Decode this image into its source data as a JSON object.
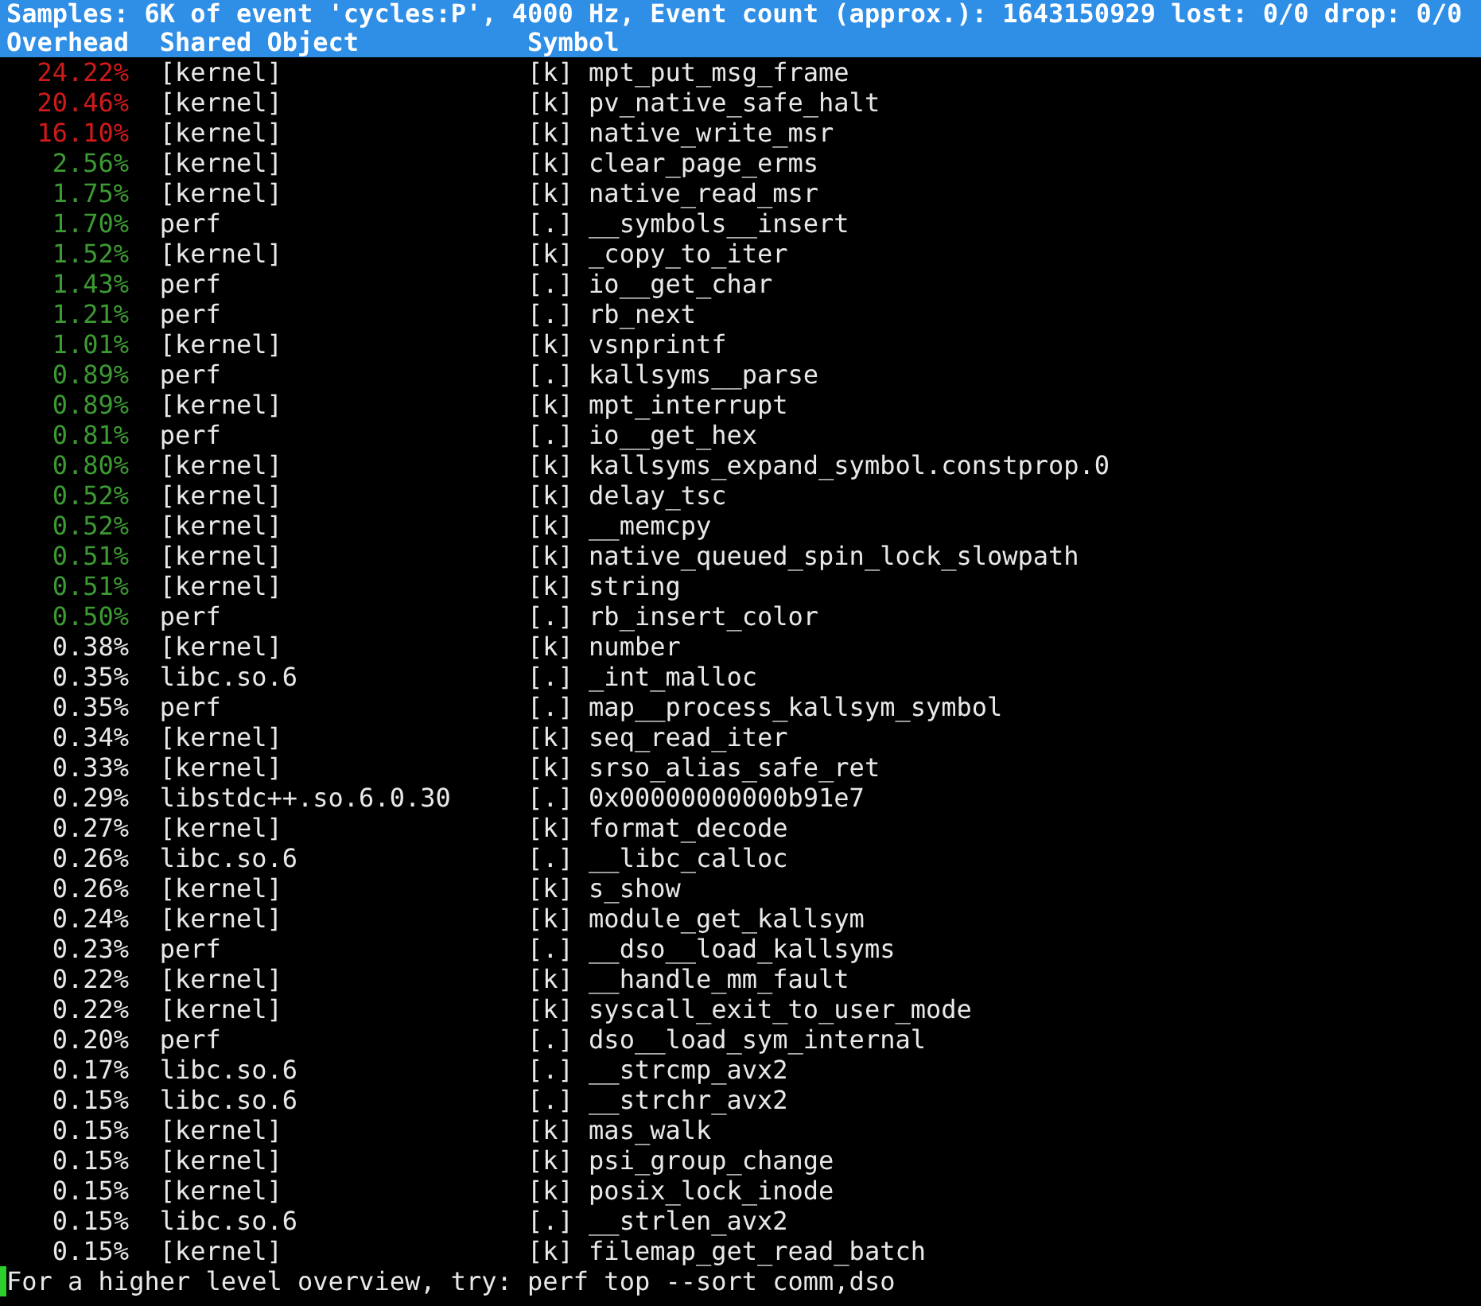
{
  "status_line": "Samples: 6K of event 'cycles:P', 4000 Hz, Event count (approx.): 1643150929 lost: 0/0 drop: 0/0",
  "columns": [
    "Overhead",
    "Shared Object",
    "Symbol"
  ],
  "rows": [
    {
      "overhead": "24.22%",
      "shared_object": "[kernel]",
      "symbol": "[k] mpt_put_msg_frame",
      "color": "#d01a1a"
    },
    {
      "overhead": "20.46%",
      "shared_object": "[kernel]",
      "symbol": "[k] pv_native_safe_halt",
      "color": "#d01a1a"
    },
    {
      "overhead": "16.10%",
      "shared_object": "[kernel]",
      "symbol": "[k] native_write_msr",
      "color": "#d01a1a"
    },
    {
      "overhead": "2.56%",
      "shared_object": "[kernel]",
      "symbol": "[k] clear_page_erms",
      "color": "#3c9a32"
    },
    {
      "overhead": "1.75%",
      "shared_object": "[kernel]",
      "symbol": "[k] native_read_msr",
      "color": "#3c9a32"
    },
    {
      "overhead": "1.70%",
      "shared_object": "perf",
      "symbol": "[.] __symbols__insert",
      "color": "#3c9a32"
    },
    {
      "overhead": "1.52%",
      "shared_object": "[kernel]",
      "symbol": "[k] _copy_to_iter",
      "color": "#3c9a32"
    },
    {
      "overhead": "1.43%",
      "shared_object": "perf",
      "symbol": "[.] io__get_char",
      "color": "#3c9a32"
    },
    {
      "overhead": "1.21%",
      "shared_object": "perf",
      "symbol": "[.] rb_next",
      "color": "#3c9a32"
    },
    {
      "overhead": "1.01%",
      "shared_object": "[kernel]",
      "symbol": "[k] vsnprintf",
      "color": "#3c9a32"
    },
    {
      "overhead": "0.89%",
      "shared_object": "perf",
      "symbol": "[.] kallsyms__parse",
      "color": "#3c9a32"
    },
    {
      "overhead": "0.89%",
      "shared_object": "[kernel]",
      "symbol": "[k] mpt_interrupt",
      "color": "#3c9a32"
    },
    {
      "overhead": "0.81%",
      "shared_object": "perf",
      "symbol": "[.] io__get_hex",
      "color": "#3c9a32"
    },
    {
      "overhead": "0.80%",
      "shared_object": "[kernel]",
      "symbol": "[k] kallsyms_expand_symbol.constprop.0",
      "color": "#3c9a32"
    },
    {
      "overhead": "0.52%",
      "shared_object": "[kernel]",
      "symbol": "[k] delay_tsc",
      "color": "#3c9a32"
    },
    {
      "overhead": "0.52%",
      "shared_object": "[kernel]",
      "symbol": "[k] __memcpy",
      "color": "#3c9a32"
    },
    {
      "overhead": "0.51%",
      "shared_object": "[kernel]",
      "symbol": "[k] native_queued_spin_lock_slowpath",
      "color": "#3c9a32"
    },
    {
      "overhead": "0.51%",
      "shared_object": "[kernel]",
      "symbol": "[k] string",
      "color": "#3c9a32"
    },
    {
      "overhead": "0.50%",
      "shared_object": "perf",
      "symbol": "[.] rb_insert_color",
      "color": "#3c9a32"
    },
    {
      "overhead": "0.38%",
      "shared_object": "[kernel]",
      "symbol": "[k] number",
      "color": "#e8e8e8"
    },
    {
      "overhead": "0.35%",
      "shared_object": "libc.so.6",
      "symbol": "[.] _int_malloc",
      "color": "#e8e8e8"
    },
    {
      "overhead": "0.35%",
      "shared_object": "perf",
      "symbol": "[.] map__process_kallsym_symbol",
      "color": "#e8e8e8"
    },
    {
      "overhead": "0.34%",
      "shared_object": "[kernel]",
      "symbol": "[k] seq_read_iter",
      "color": "#e8e8e8"
    },
    {
      "overhead": "0.33%",
      "shared_object": "[kernel]",
      "symbol": "[k] srso_alias_safe_ret",
      "color": "#e8e8e8"
    },
    {
      "overhead": "0.29%",
      "shared_object": "libstdc++.so.6.0.30",
      "symbol": "[.] 0x00000000000b91e7",
      "color": "#e8e8e8"
    },
    {
      "overhead": "0.27%",
      "shared_object": "[kernel]",
      "symbol": "[k] format_decode",
      "color": "#e8e8e8"
    },
    {
      "overhead": "0.26%",
      "shared_object": "libc.so.6",
      "symbol": "[.] __libc_calloc",
      "color": "#e8e8e8"
    },
    {
      "overhead": "0.26%",
      "shared_object": "[kernel]",
      "symbol": "[k] s_show",
      "color": "#e8e8e8"
    },
    {
      "overhead": "0.24%",
      "shared_object": "[kernel]",
      "symbol": "[k] module_get_kallsym",
      "color": "#e8e8e8"
    },
    {
      "overhead": "0.23%",
      "shared_object": "perf",
      "symbol": "[.] __dso__load_kallsyms",
      "color": "#e8e8e8"
    },
    {
      "overhead": "0.22%",
      "shared_object": "[kernel]",
      "symbol": "[k] __handle_mm_fault",
      "color": "#e8e8e8"
    },
    {
      "overhead": "0.22%",
      "shared_object": "[kernel]",
      "symbol": "[k] syscall_exit_to_user_mode",
      "color": "#e8e8e8"
    },
    {
      "overhead": "0.20%",
      "shared_object": "perf",
      "symbol": "[.] dso__load_sym_internal",
      "color": "#e8e8e8"
    },
    {
      "overhead": "0.17%",
      "shared_object": "libc.so.6",
      "symbol": "[.] __strcmp_avx2",
      "color": "#e8e8e8"
    },
    {
      "overhead": "0.15%",
      "shared_object": "libc.so.6",
      "symbol": "[.] __strchr_avx2",
      "color": "#e8e8e8"
    },
    {
      "overhead": "0.15%",
      "shared_object": "[kernel]",
      "symbol": "[k] mas_walk",
      "color": "#e8e8e8"
    },
    {
      "overhead": "0.15%",
      "shared_object": "[kernel]",
      "symbol": "[k] psi_group_change",
      "color": "#e8e8e8"
    },
    {
      "overhead": "0.15%",
      "shared_object": "[kernel]",
      "symbol": "[k] posix_lock_inode",
      "color": "#e8e8e8"
    },
    {
      "overhead": "0.15%",
      "shared_object": "libc.so.6",
      "symbol": "[.] __strlen_avx2",
      "color": "#e8e8e8"
    },
    {
      "overhead": "0.15%",
      "shared_object": "[kernel]",
      "symbol": "[k] filemap_get_read_batch",
      "color": "#e8e8e8"
    }
  ],
  "hint_line": "For a higher level overview, try: perf top --sort comm,dso"
}
